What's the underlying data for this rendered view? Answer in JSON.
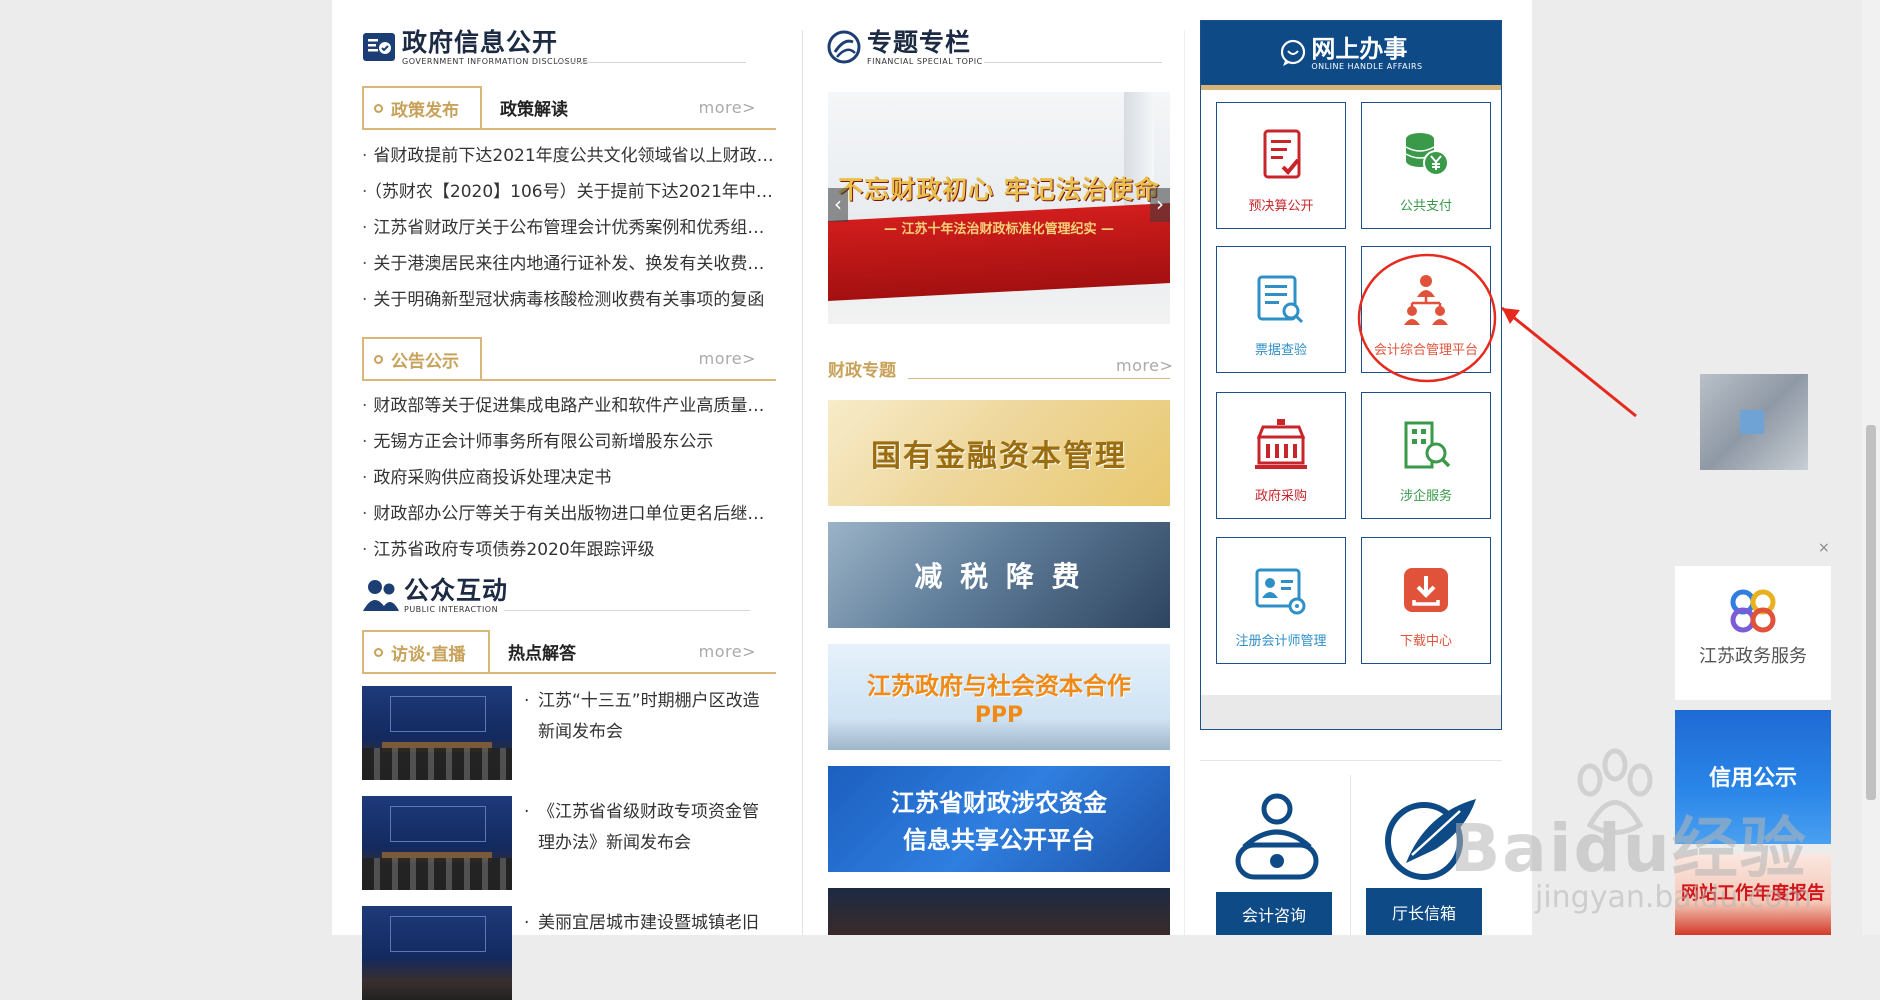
{
  "gov_info": {
    "title": "政府信息公开",
    "subtitle": "GOVERNMENT INFORMATION DISCLOSURE",
    "tab_active": "政策发布",
    "tab_other": "政策解读",
    "more": "more>",
    "news": [
      "省财政提前下达2021年度公共文化领域省以上财政…",
      "（苏财农【2020】106号）关于提前下达2021年中…",
      "江苏省财政厅关于公布管理会计优秀案例和优秀组…",
      "关于港澳居民来往内地通行证补发、换发有关收费…",
      "关于明确新型冠状病毒核酸检测收费有关事项的复函"
    ]
  },
  "notices": {
    "tab_active": "公告公示",
    "more": "more>",
    "news": [
      "财政部等关于促进集成电路产业和软件产业高质量…",
      "无锡方正会计师事务所有限公司新增股东公示",
      "政府采购供应商投诉处理决定书",
      "财政部办公厅等关于有关出版物进口单位更名后继…",
      "江苏省政府专项债券2020年跟踪评级"
    ]
  },
  "public": {
    "title": "公众互动",
    "subtitle": "PUBLIC INTERACTION",
    "tab_active": "访谈·直播",
    "tab_other": "热点解答",
    "more": "more>",
    "items": [
      "江苏“十三五”时期棚户区改造新闻发布会",
      "《江苏省省级财政专项资金管理办法》新闻发布会",
      "美丽宜居城市建设暨城镇老旧"
    ]
  },
  "topic": {
    "title": "专题专栏",
    "subtitle": "FINANCIAL SPECIAL TOPIC",
    "carousel_main": "不忘财政初心 牢记法治使命",
    "carousel_sub": "— 江苏十年法治财政标准化管理纪实 —",
    "prev": "‹",
    "next": "›",
    "finance_label": "财政专题",
    "more": "more>",
    "banners": [
      "国有金融资本管理",
      "减 税 降 费",
      "江苏政府与社会资本合作",
      "PPP",
      "江苏省财政涉农资金",
      "信息共享公开平台"
    ]
  },
  "online": {
    "title": "网上办事",
    "subtitle": "ONLINE HANDLE AFFAIRS",
    "items": [
      {
        "label": "预决算公开",
        "color": "#c8252b"
      },
      {
        "label": "公共支付",
        "color": "#3a9a4a"
      },
      {
        "label": "票据查验",
        "color": "#2f8fc7"
      },
      {
        "label": "会计综合管理平台",
        "color": "#e0533a"
      },
      {
        "label": "政府采购",
        "color": "#c8252b"
      },
      {
        "label": "涉企服务",
        "color": "#3a9a4a"
      },
      {
        "label": "注册会计师管理",
        "color": "#2f8fc7"
      },
      {
        "label": "下载中心",
        "color": "#e0533a"
      }
    ]
  },
  "bottom_buttons": [
    "会计咨询",
    "厅长信箱"
  ],
  "side": {
    "close": "×",
    "gov_service": "江苏政务服务",
    "credit": "信用公示",
    "report": "网站工作年度报告"
  },
  "watermark": {
    "brand": "Baidu经验",
    "url": "jingyan.baidu.com"
  }
}
